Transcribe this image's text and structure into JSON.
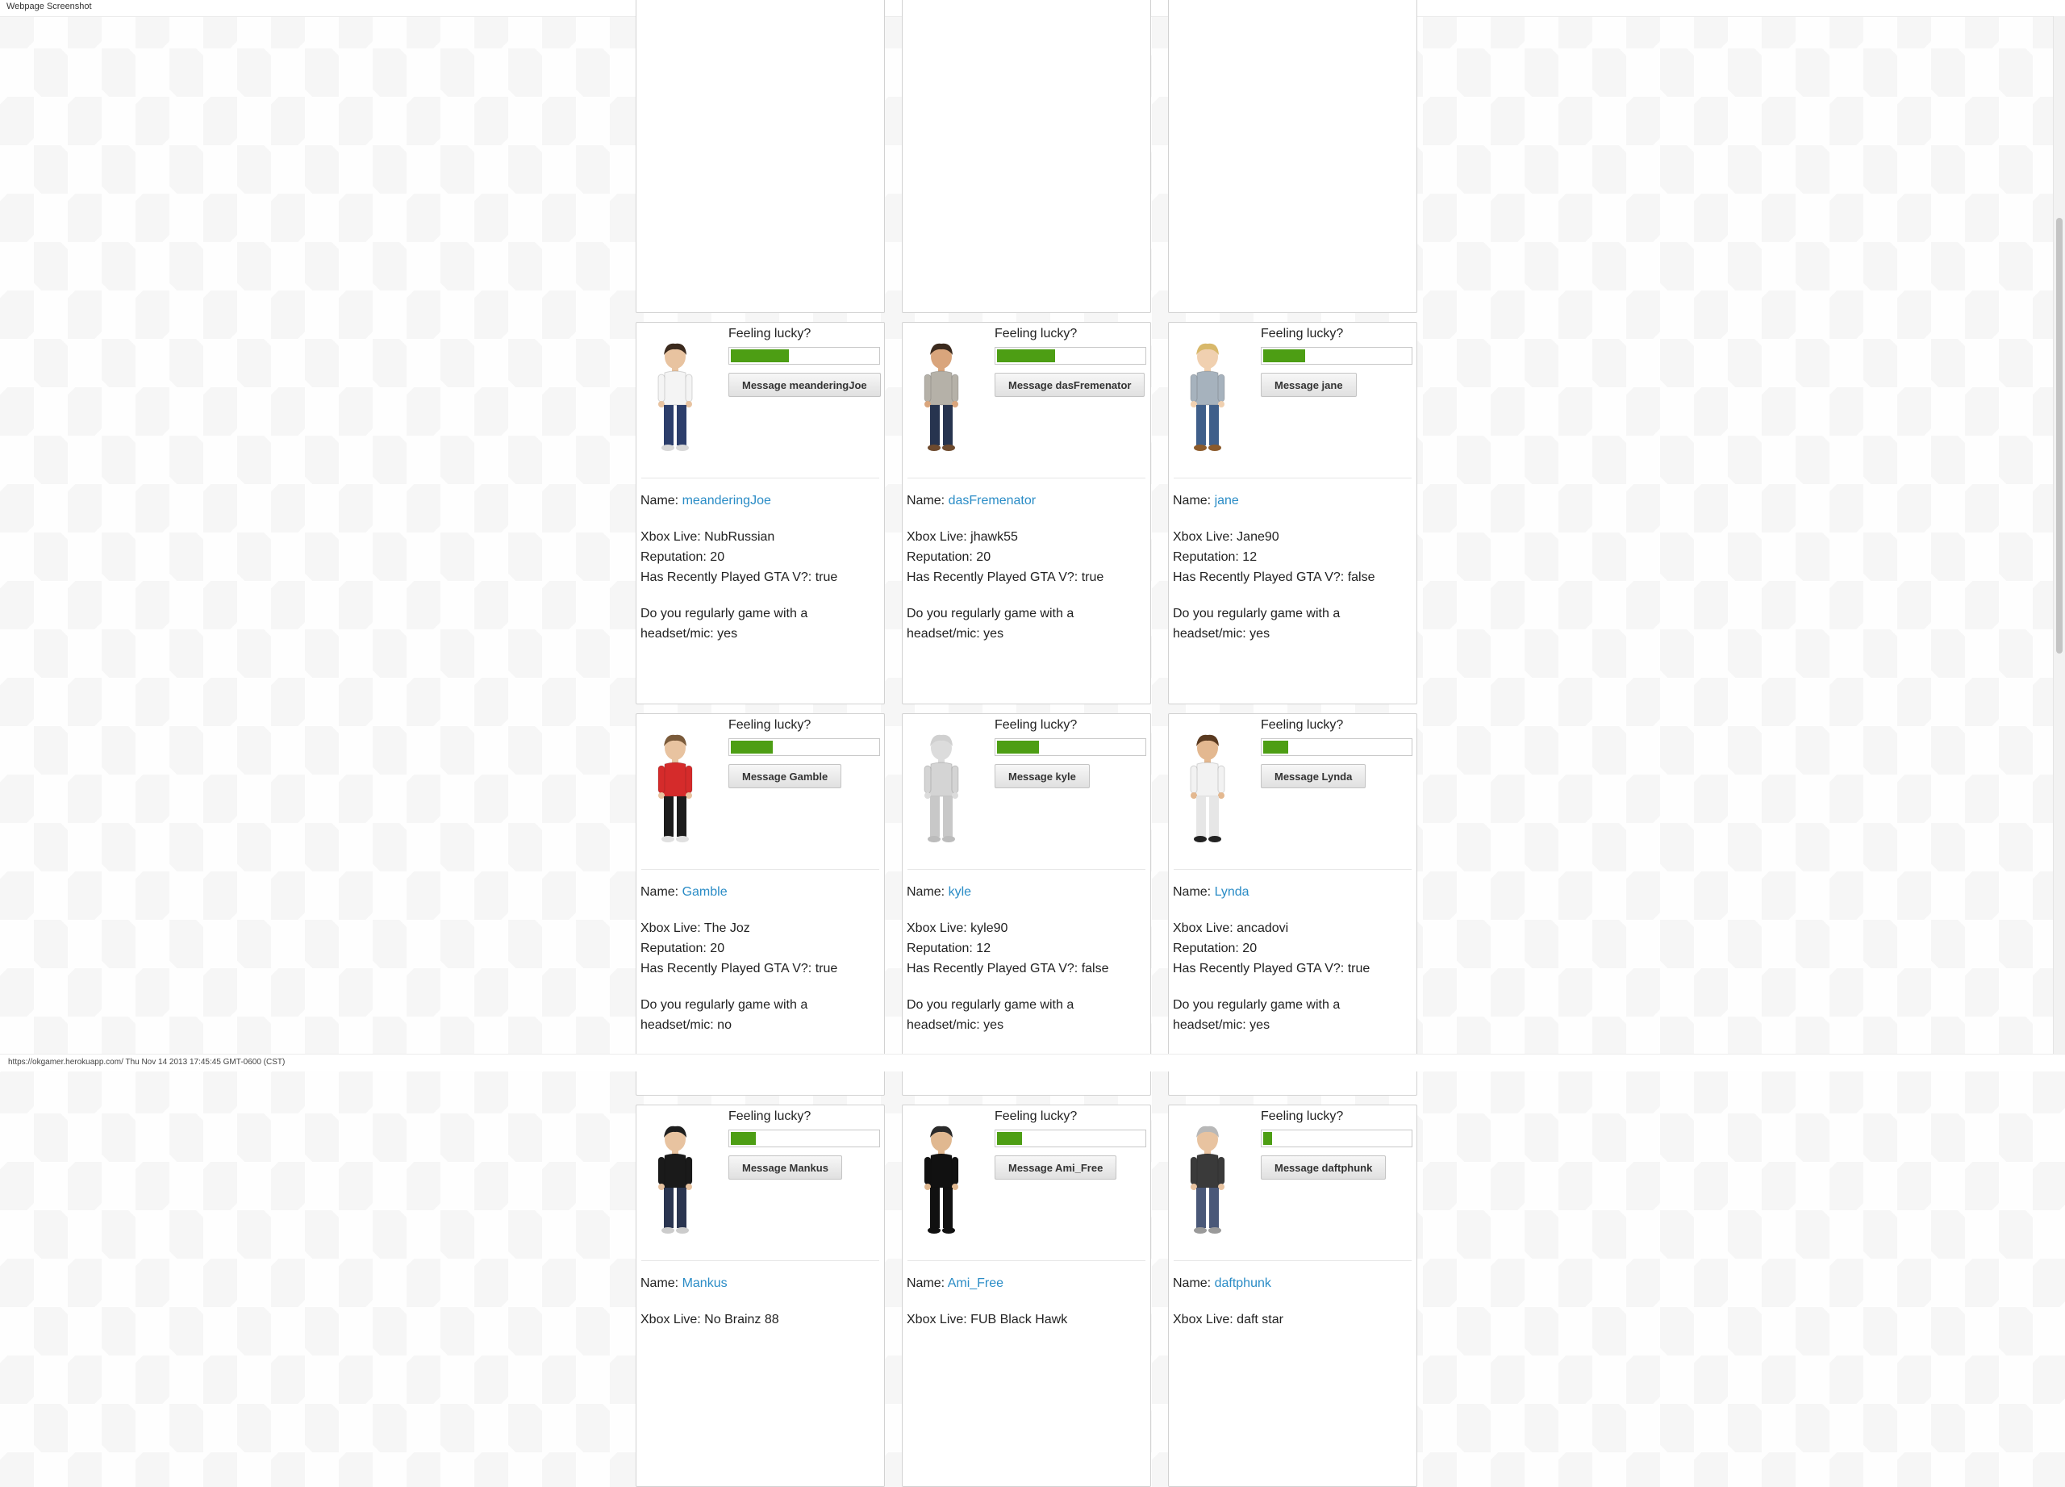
{
  "window": {
    "title": "Webpage Screenshot",
    "status": "https://okgamer.herokuapp.com/ Thu Nov 14 2013 17:45:45 GMT-0600 (CST)"
  },
  "labels": {
    "feeling_lucky": "Feeling lucky?",
    "name": "Name:",
    "xbox_live": "Xbox Live:",
    "reputation": "Reputation:",
    "gta": "Has Recently Played GTA V?:",
    "headset_question": "Do you regularly game with a headset/mic:"
  },
  "cards": [
    {
      "name": "",
      "message_label": "",
      "lucky": 0,
      "xbox_live": "",
      "reputation": "",
      "gta": "",
      "headset": "",
      "avatar": "none"
    },
    {
      "name": "",
      "message_label": "",
      "lucky": 0,
      "xbox_live": "",
      "reputation": "",
      "gta": "",
      "headset": "",
      "avatar": "none"
    },
    {
      "name": "",
      "message_label": "",
      "lucky": 0,
      "xbox_live": "",
      "reputation": "",
      "gta": "",
      "headset": "",
      "avatar": "none"
    },
    {
      "name": "meanderingJoe",
      "message_label": "Message meanderingJoe",
      "lucky": 0.39,
      "xbox_live": "NubRussian",
      "reputation": "20",
      "gta": "true",
      "headset": "yes",
      "avatar": "white-shirt-avatar",
      "colors": {
        "hair": "#3b2a1e",
        "skin": "#e8c3a0",
        "shirt": "#f4f4f4",
        "pants": "#2c3e6b",
        "shoes": "#d8d8d8"
      }
    },
    {
      "name": "dasFremenator",
      "message_label": "Message dasFremenator",
      "lucky": 0.39,
      "xbox_live": "jhawk55",
      "reputation": "20",
      "gta": "true",
      "headset": "yes",
      "avatar": "grey-jacket-avatar",
      "colors": {
        "hair": "#3b2a1e",
        "skin": "#d9a57c",
        "shirt": "#b5b1a8",
        "pants": "#27344f",
        "shoes": "#6d4a2e"
      }
    },
    {
      "name": "jane",
      "message_label": "Message jane",
      "lucky": 0.28,
      "xbox_live": "Jane90",
      "reputation": "12",
      "gta": "false",
      "headset": "yes",
      "avatar": "blonde-avatar",
      "colors": {
        "hair": "#d8b86a",
        "skin": "#f0d0b0",
        "shirt": "#a6b2bd",
        "pants": "#3f5f8a",
        "shoes": "#8b5a2b"
      }
    },
    {
      "name": "Gamble",
      "message_label": "Message Gamble",
      "lucky": 0.28,
      "xbox_live": "The Joz",
      "reputation": "20",
      "gta": "true",
      "headset": "no",
      "avatar": "cowboy-hat-avatar",
      "colors": {
        "hair": "#7a5a3a",
        "skin": "#e8c3a0",
        "shirt": "#d52b2b",
        "pants": "#1c1c1c",
        "shoes": "#e0e0e0"
      }
    },
    {
      "name": "kyle",
      "message_label": "Message kyle",
      "lucky": 0.28,
      "xbox_live": "kyle90",
      "reputation": "12",
      "gta": "false",
      "headset": "yes",
      "avatar": "default-grey-avatar",
      "colors": {
        "hair": "#d0d0d0",
        "skin": "#dcdcdc",
        "shirt": "#d4d4d4",
        "pants": "#c8c8c8",
        "shoes": "#bcbcbc"
      }
    },
    {
      "name": "Lynda",
      "message_label": "Message Lynda",
      "lucky": 0.17,
      "xbox_live": "ancadovi",
      "reputation": "20",
      "gta": "true",
      "headset": "yes",
      "avatar": "dress-avatar",
      "colors": {
        "hair": "#5a3a20",
        "skin": "#e3b890",
        "shirt": "#f2f2f2",
        "pants": "#e6e6e6",
        "shoes": "#222222"
      }
    },
    {
      "name": "Mankus",
      "message_label": "Message Mankus",
      "lucky": 0.17,
      "xbox_live": "No Brainz 88",
      "reputation": "",
      "gta": "",
      "headset": "",
      "avatar": "black-shirt-avatar",
      "colors": {
        "hair": "#1e1e1e",
        "skin": "#e8c3a0",
        "shirt": "#1a1a1a",
        "pants": "#2a3550",
        "shoes": "#cccccc"
      }
    },
    {
      "name": "Ami_Free",
      "message_label": "Message Ami_Free",
      "lucky": 0.17,
      "xbox_live": "FUB Black Hawk",
      "reputation": "",
      "gta": "",
      "headset": "",
      "avatar": "suit-avatar",
      "colors": {
        "hair": "#2a2a2a",
        "skin": "#e0b890",
        "shirt": "#111111",
        "pants": "#111111",
        "shoes": "#111111"
      }
    },
    {
      "name": "daftphunk",
      "message_label": "Message daftphunk",
      "lucky": 0.06,
      "xbox_live": "daft star",
      "reputation": "",
      "gta": "",
      "headset": "",
      "avatar": "vest-avatar",
      "colors": {
        "hair": "#b8b8b8",
        "skin": "#e8c3a0",
        "shirt": "#3a3a3a",
        "pants": "#4a5878",
        "shoes": "#9a9a9a"
      }
    }
  ]
}
